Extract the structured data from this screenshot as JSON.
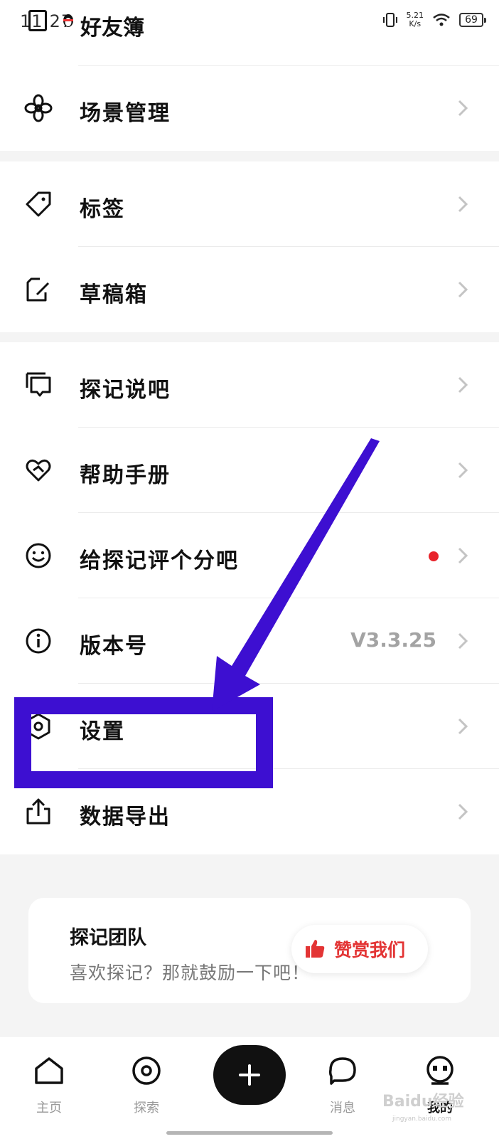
{
  "status_bar": {
    "time": "11:27",
    "app_title": "好友簿",
    "net_speed": "5.21",
    "net_speed_unit": "K/s",
    "battery": "69"
  },
  "menu": {
    "group1": [
      {
        "label": "场景管理",
        "icon": "flower-icon"
      }
    ],
    "group2": [
      {
        "label": "标签",
        "icon": "tag-icon"
      },
      {
        "label": "草稿箱",
        "icon": "draft-edit-icon"
      }
    ],
    "group3": [
      {
        "label": "探记说吧",
        "icon": "chat-bubble-icon"
      },
      {
        "label": "帮助手册",
        "icon": "heart-help-icon"
      },
      {
        "label": "给探记评个分吧",
        "icon": "smile-icon"
      },
      {
        "label": "版本号",
        "icon": "info-icon",
        "value": "V3.3.25"
      },
      {
        "label": "设置",
        "icon": "settings-icon"
      },
      {
        "label": "数据导出",
        "icon": "share-export-icon"
      }
    ]
  },
  "team_card": {
    "title": "探记团队",
    "subtitle": "喜欢探记？那就鼓励一下吧！",
    "reward_button": "赞赏我们"
  },
  "tab_bar": {
    "tabs": [
      {
        "label": "主页",
        "icon": "home-icon"
      },
      {
        "label": "探索",
        "icon": "explore-icon"
      },
      {
        "label": "消息",
        "icon": "message-icon"
      },
      {
        "label": "我的",
        "icon": "profile-face-icon",
        "active": true
      }
    ]
  },
  "watermark": {
    "text": "Baidu经验",
    "sub": "jingyan.baidu.com"
  },
  "colors": {
    "accent_red": "#e33434",
    "annotation": "#3d0fd1",
    "background": "#f4f4f4"
  }
}
